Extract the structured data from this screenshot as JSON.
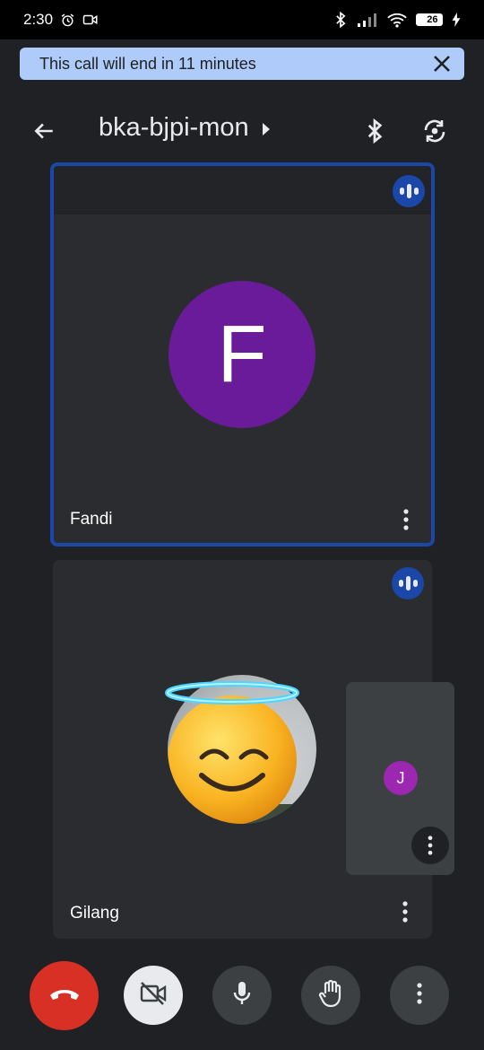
{
  "status_bar": {
    "time": "2:30",
    "battery": "26",
    "icons": [
      "alarm-icon",
      "video-record-icon",
      "bluetooth-icon",
      "signal-icon",
      "wifi-icon",
      "battery-icon",
      "charging-icon"
    ]
  },
  "banner": {
    "text": "This call will end in 11 minutes",
    "close_icon": "close-icon"
  },
  "header": {
    "meeting_code": "bka-bjpi-mon",
    "icons": [
      "back-arrow-icon",
      "caret-right-icon",
      "bluetooth-audio-icon",
      "switch-camera-icon"
    ]
  },
  "participants": [
    {
      "name": "Fandi",
      "initial": "F",
      "avatar_color": "#6a1b9a",
      "speaking": true
    },
    {
      "name": "Gilang",
      "avatar": "emoji-halo-smile",
      "speaking": true
    }
  ],
  "self_view": {
    "initial": "J",
    "avatar_color": "#9c27b0"
  },
  "controls": [
    {
      "name": "end-call",
      "icon": "phone-hangup-icon",
      "color": "#d93025"
    },
    {
      "name": "camera-toggle",
      "icon": "videocam-off-icon",
      "color": "#e8eaed"
    },
    {
      "name": "mic-toggle",
      "icon": "mic-icon",
      "color": "#3c4043"
    },
    {
      "name": "raise-hand",
      "icon": "hand-icon",
      "color": "#3c4043"
    },
    {
      "name": "more-options",
      "icon": "more-vert-icon",
      "color": "#3c4043"
    }
  ],
  "colors": {
    "background": "#202124",
    "tile": "#2b2c2f",
    "active_border": "#1a47a8",
    "banner": "#aecbfa"
  }
}
